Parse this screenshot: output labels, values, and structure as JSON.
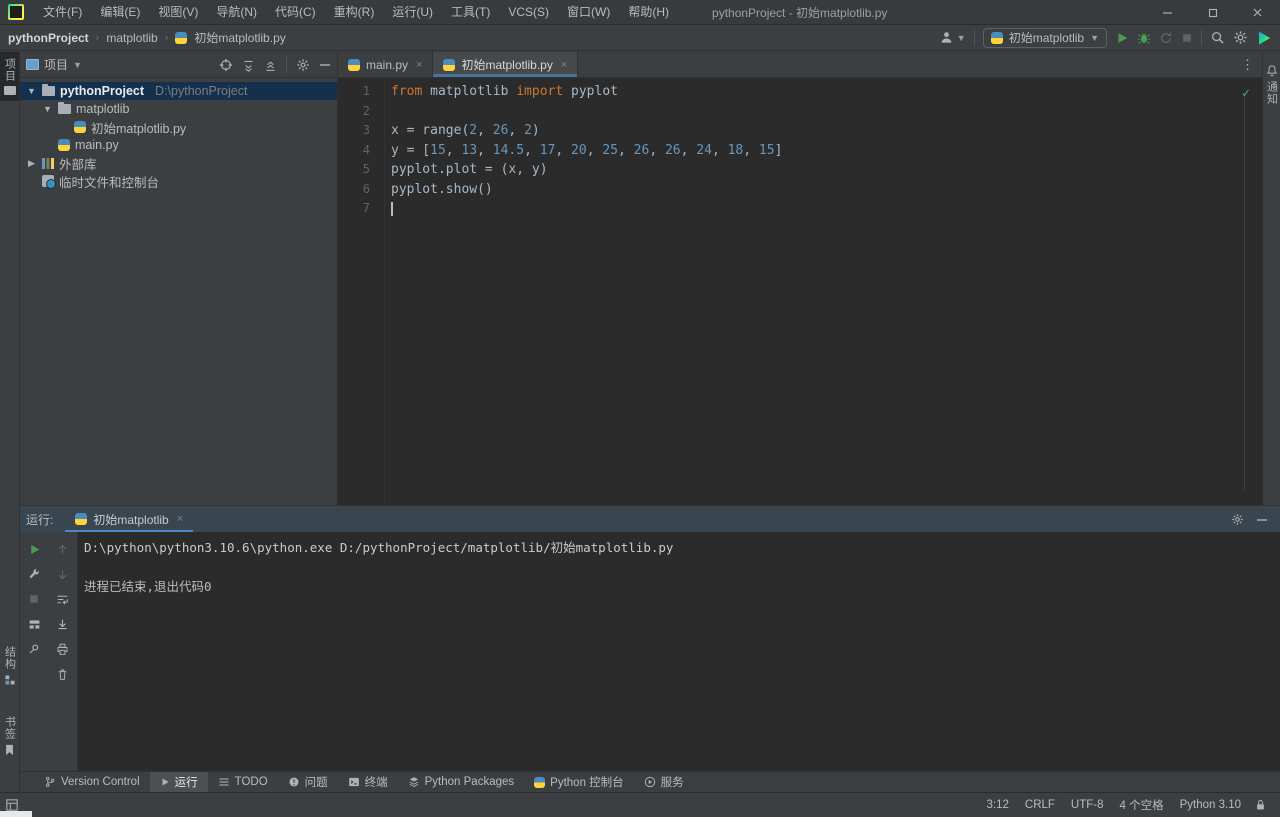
{
  "window": {
    "title": "pythonProject - 初始matplotlib.py"
  },
  "menubar": {
    "items": [
      "文件(F)",
      "编辑(E)",
      "视图(V)",
      "导航(N)",
      "代码(C)",
      "重构(R)",
      "运行(U)",
      "工具(T)",
      "VCS(S)",
      "窗口(W)",
      "帮助(H)"
    ]
  },
  "navbar": {
    "breadcrumbs": [
      "pythonProject",
      "matplotlib",
      "初始matplotlib.py"
    ],
    "run_config": "初始matplotlib"
  },
  "stripes": {
    "left_top": {
      "label": "项目"
    },
    "left_bottom": [
      {
        "label": "结构",
        "icon": "structure"
      },
      {
        "label": "书签",
        "icon": "bookmark"
      }
    ],
    "right": {
      "label": "通知"
    }
  },
  "project": {
    "header": "项目",
    "tree": [
      {
        "label": "pythonProject",
        "hint": "D:\\pythonProject",
        "depth": 0,
        "icon": "folder",
        "arrow": "open",
        "selected": true,
        "bold": true
      },
      {
        "label": "matplotlib",
        "depth": 1,
        "icon": "folder",
        "arrow": "open"
      },
      {
        "label": "初始matplotlib.py",
        "depth": 2,
        "icon": "python"
      },
      {
        "label": "main.py",
        "depth": 1,
        "icon": "python"
      },
      {
        "label": "外部库",
        "depth": 0,
        "icon": "libs",
        "arrow": "closed"
      },
      {
        "label": "临时文件和控制台",
        "depth": 0,
        "icon": "scratch"
      }
    ]
  },
  "editor": {
    "tabs": [
      {
        "label": "main.py",
        "active": false
      },
      {
        "label": "初始matplotlib.py",
        "active": true
      }
    ],
    "lines": [
      [
        {
          "t": "from",
          "c": "kw"
        },
        {
          "t": " matplotlib ",
          "c": "def"
        },
        {
          "t": "import",
          "c": "kw"
        },
        {
          "t": " pyplot",
          "c": "def"
        }
      ],
      [],
      [
        {
          "t": "x = range(",
          "c": "def"
        },
        {
          "t": "2",
          "c": "num"
        },
        {
          "t": ", ",
          "c": "def"
        },
        {
          "t": "26",
          "c": "num"
        },
        {
          "t": ", ",
          "c": "def"
        },
        {
          "t": "2",
          "c": "num"
        },
        {
          "t": ")",
          "c": "def"
        }
      ],
      [
        {
          "t": "y = [",
          "c": "def"
        },
        {
          "t": "15",
          "c": "num"
        },
        {
          "t": ", ",
          "c": "def"
        },
        {
          "t": "13",
          "c": "num"
        },
        {
          "t": ", ",
          "c": "def"
        },
        {
          "t": "14.5",
          "c": "num"
        },
        {
          "t": ", ",
          "c": "def"
        },
        {
          "t": "17",
          "c": "num"
        },
        {
          "t": ", ",
          "c": "def"
        },
        {
          "t": "20",
          "c": "num"
        },
        {
          "t": ", ",
          "c": "def"
        },
        {
          "t": "25",
          "c": "num"
        },
        {
          "t": ", ",
          "c": "def"
        },
        {
          "t": "26",
          "c": "num"
        },
        {
          "t": ", ",
          "c": "def"
        },
        {
          "t": "26",
          "c": "num"
        },
        {
          "t": ", ",
          "c": "def"
        },
        {
          "t": "24",
          "c": "num"
        },
        {
          "t": ", ",
          "c": "def"
        },
        {
          "t": "18",
          "c": "num"
        },
        {
          "t": ", ",
          "c": "def"
        },
        {
          "t": "15",
          "c": "num"
        },
        {
          "t": "]",
          "c": "def"
        }
      ],
      [
        {
          "t": "pyplot.plot = (x, y)",
          "c": "def"
        }
      ],
      [
        {
          "t": "pyplot.show()",
          "c": "def"
        }
      ],
      []
    ],
    "caret_line": 7
  },
  "run": {
    "label": "运行:",
    "tab": "初始matplotlib",
    "console": [
      {
        "text": "D:\\python\\python3.10.6\\python.exe D:/pythonProject/matplotlib/初始matplotlib.py",
        "kind": "cmd"
      },
      {
        "text": "",
        "kind": "blank"
      },
      {
        "text": "进程已结束,退出代码0",
        "kind": "exit"
      }
    ]
  },
  "bottombar": {
    "items": [
      {
        "label": "Version Control",
        "icon": "branch"
      },
      {
        "label": "运行",
        "icon": "play",
        "active": true
      },
      {
        "label": "TODO",
        "icon": "todo"
      },
      {
        "label": "问题",
        "icon": "problems"
      },
      {
        "label": "终端",
        "icon": "terminal"
      },
      {
        "label": "Python Packages",
        "icon": "packages"
      },
      {
        "label": "Python 控制台",
        "icon": "pyconsole"
      },
      {
        "label": "服务",
        "icon": "services"
      }
    ]
  },
  "statusbar": {
    "items": [
      "3:12",
      "CRLF",
      "UTF-8",
      "4 个空格",
      "Python 3.10"
    ]
  },
  "colors": {
    "accent": "#4A88C7",
    "keyword": "#CC7832",
    "number": "#6897BB",
    "editor_text": "#A9B7C6",
    "run_green": "#499C54",
    "selection": "#14304C"
  }
}
